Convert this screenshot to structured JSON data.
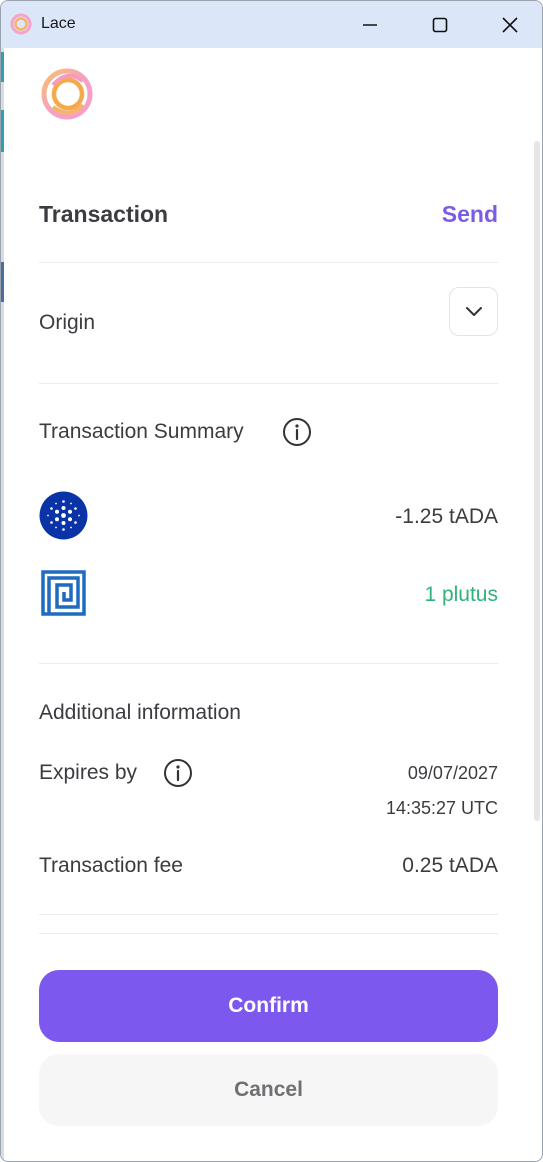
{
  "window": {
    "title": "Lace"
  },
  "header": {
    "title": "Transaction",
    "type_label": "Send"
  },
  "origin": {
    "label": "Origin"
  },
  "summary": {
    "title": "Transaction Summary",
    "items": [
      {
        "icon": "cardano-icon",
        "amount": "-1.25 tADA",
        "color": "#3d3b40"
      },
      {
        "icon": "plutus-token-icon",
        "amount": "1 plutus",
        "color": "#2fb37a"
      }
    ]
  },
  "additional": {
    "title": "Additional information",
    "expires_label": "Expires by",
    "expires_date": "09/07/2027",
    "expires_time": "14:35:27 UTC",
    "fee_label": "Transaction fee",
    "fee_value": "0.25 tADA"
  },
  "actions": {
    "confirm": "Confirm",
    "cancel": "Cancel"
  },
  "colors": {
    "accent": "#7c5ce6",
    "positive": "#2fb37a",
    "button_primary": "#7d58ee"
  }
}
